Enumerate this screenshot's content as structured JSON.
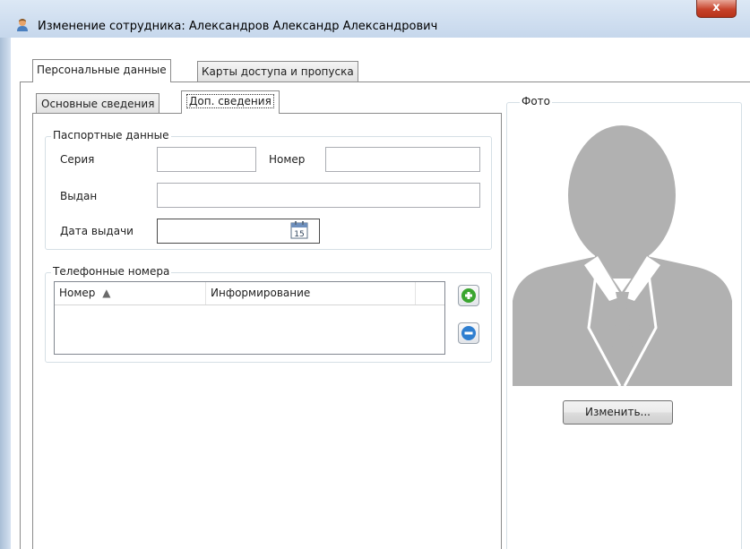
{
  "window": {
    "title": "Изменение сотрудника: Александров Александр Александрович",
    "close_glyph": "x",
    "icon": "user-icon"
  },
  "main_tabs": [
    {
      "label": "Персональные данные",
      "active": true
    },
    {
      "label": "Карты доступа и пропуска",
      "active": false
    }
  ],
  "sub_tabs": [
    {
      "label": "Основные сведения",
      "active": false
    },
    {
      "label": "Доп. сведения",
      "active": true
    }
  ],
  "passport": {
    "legend": "Паспортные данные",
    "series_label": "Серия",
    "series_value": "",
    "number_label": "Номер",
    "number_value": "",
    "issued_label": "Выдан",
    "issued_value": "",
    "date_label": "Дата выдачи",
    "date_value": "",
    "calendar_icon": "calendar-icon",
    "calendar_day": "15"
  },
  "phones": {
    "legend": "Телефонные номера",
    "columns": [
      "Номер",
      "Информирование"
    ],
    "sort_indicator": "▲",
    "rows": [],
    "add_icon": "plus-icon",
    "remove_icon": "minus-icon"
  },
  "photo": {
    "legend": "Фото",
    "placeholder_icon": "person-silhouette-icon",
    "change_button": "Изменить..."
  },
  "colors": {
    "silhouette": "#b1b1b1",
    "add_green": "#3aa52f",
    "remove_blue": "#2f7fd0",
    "close_red": "#c7432b"
  }
}
